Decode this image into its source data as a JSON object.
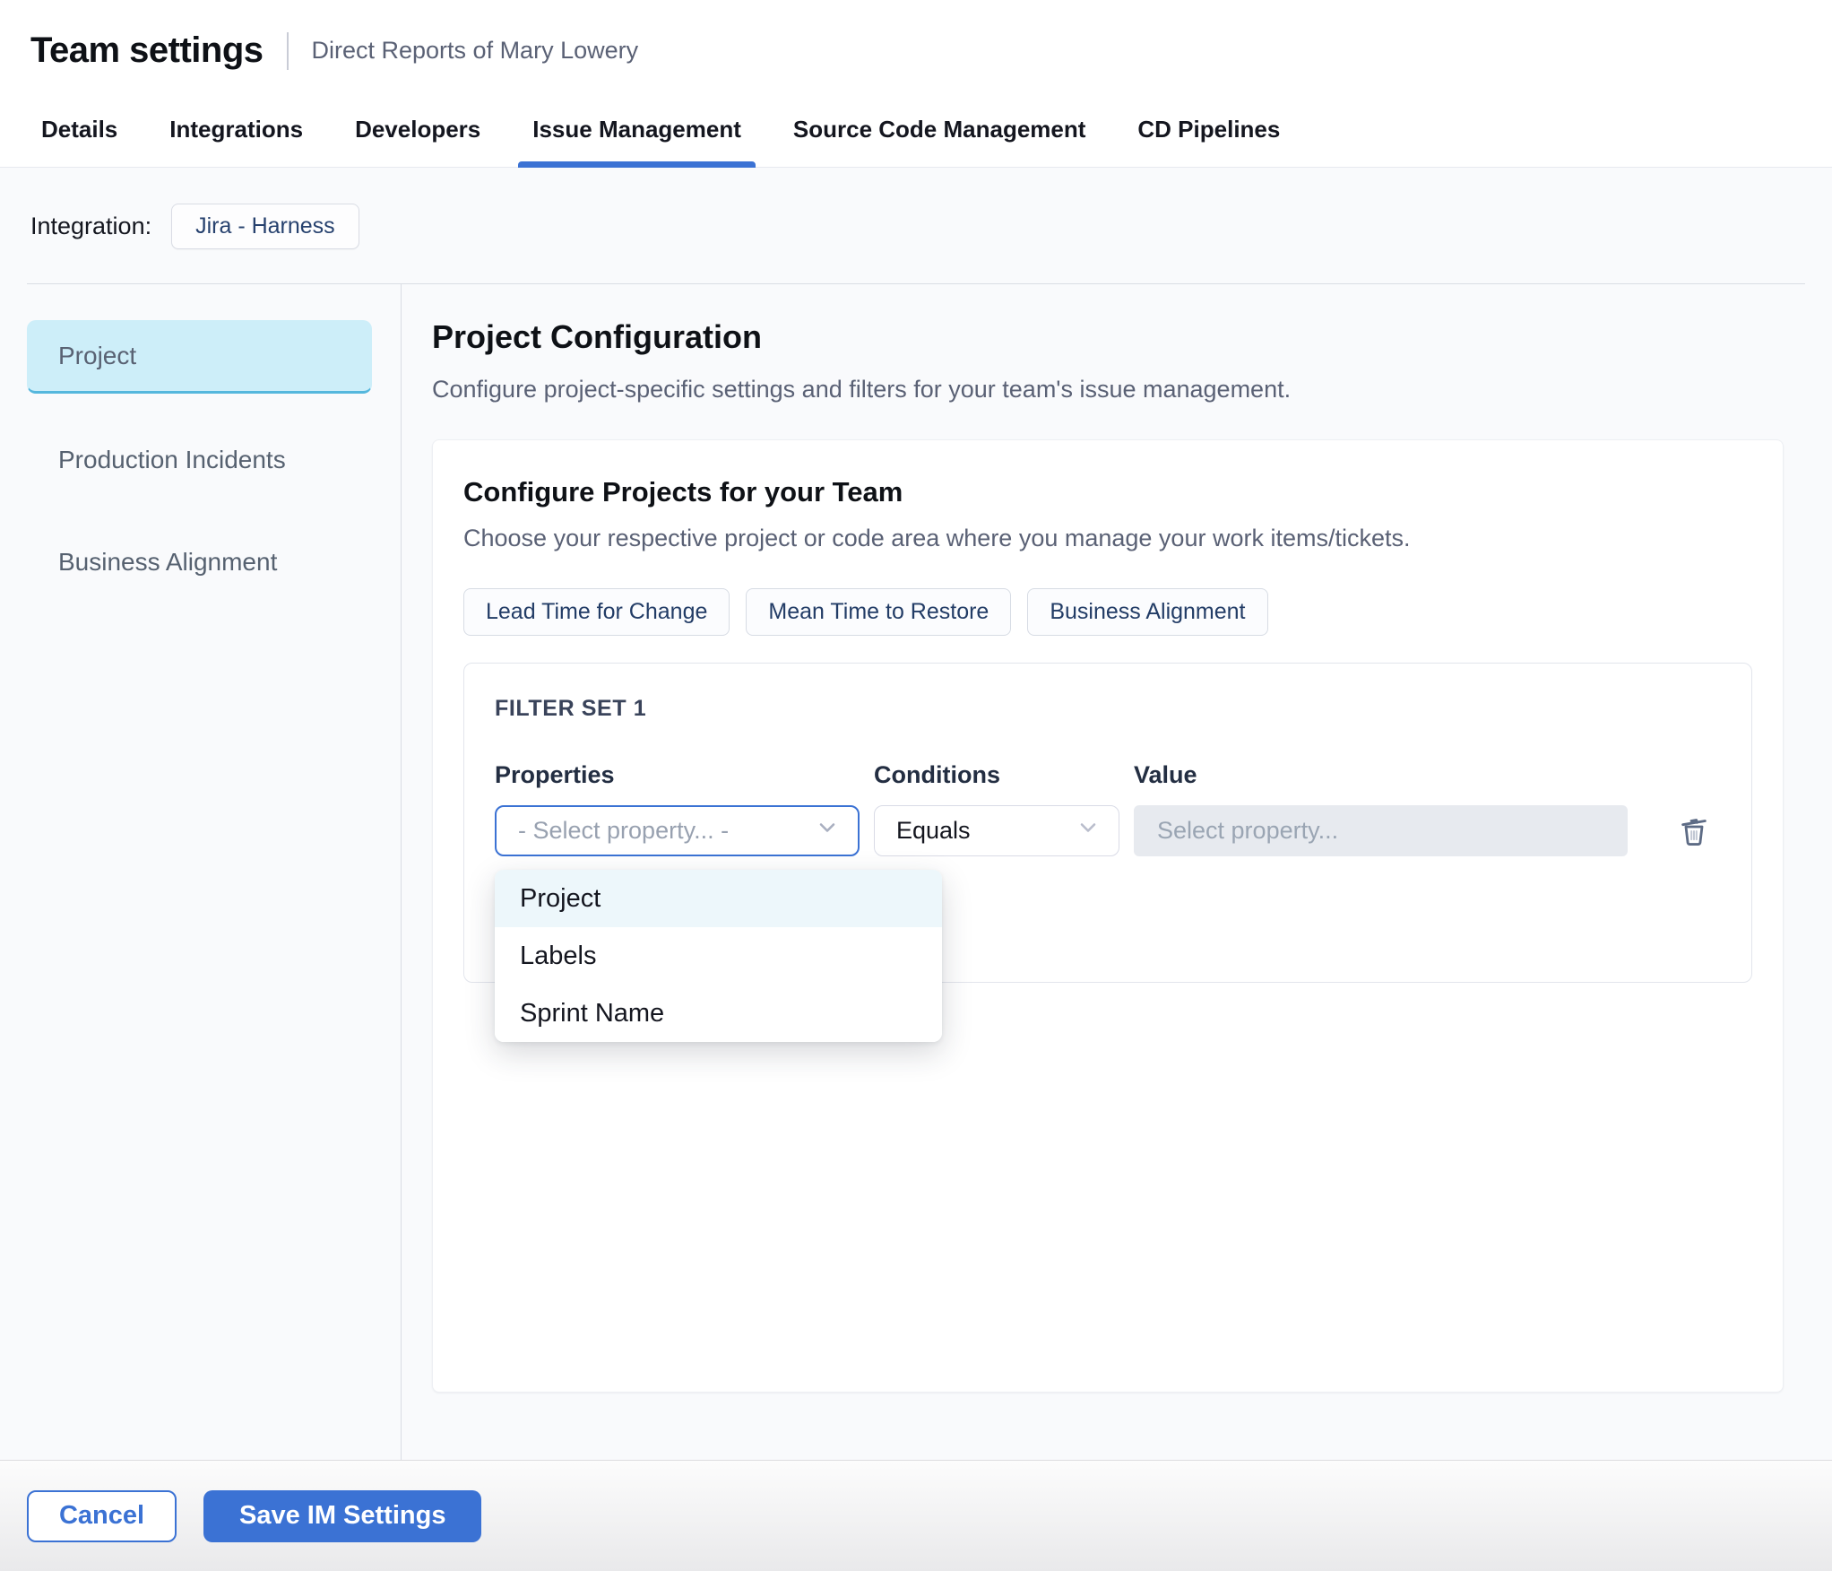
{
  "header": {
    "title": "Team settings",
    "subtitle": "Direct Reports of Mary Lowery"
  },
  "tabs": [
    {
      "label": "Details",
      "active": false
    },
    {
      "label": "Integrations",
      "active": false
    },
    {
      "label": "Developers",
      "active": false
    },
    {
      "label": "Issue Management",
      "active": true
    },
    {
      "label": "Source Code Management",
      "active": false
    },
    {
      "label": "CD Pipelines",
      "active": false
    }
  ],
  "integration": {
    "label": "Integration:",
    "value": "Jira - Harness"
  },
  "sidebar": {
    "items": [
      {
        "label": "Project",
        "active": true
      },
      {
        "label": "Production Incidents",
        "active": false
      },
      {
        "label": "Business Alignment",
        "active": false
      }
    ]
  },
  "main": {
    "title": "Project Configuration",
    "description": "Configure project-specific settings and filters for your team's issue management.",
    "card": {
      "title": "Configure Projects for your Team",
      "description": "Choose your respective project or code area where you manage your work items/tickets.",
      "chips": [
        "Lead Time for Change",
        "Mean Time to Restore",
        "Business Alignment"
      ],
      "filter_set": {
        "title": "FILTER SET 1",
        "columns": [
          "Properties",
          "Conditions",
          "Value"
        ],
        "property_placeholder": "- Select property... -",
        "condition_value": "Equals",
        "value_placeholder": "Select property...",
        "dropdown": {
          "options": [
            "Project",
            "Labels",
            "Sprint Name"
          ],
          "highlighted_option": "Project"
        }
      }
    }
  },
  "footer": {
    "cancel_label": "Cancel",
    "save_label": "Save IM Settings"
  },
  "colors": {
    "primary": "#3B72D4",
    "selected-bg": "#CDEEF9",
    "selected-border": "#55B7DD",
    "dropdown-highlight": "#EDF7FB"
  }
}
